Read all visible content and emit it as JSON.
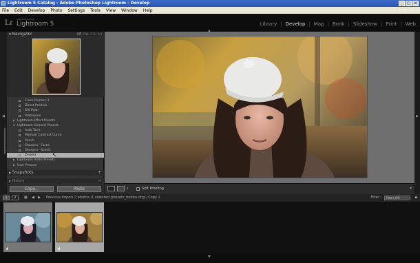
{
  "window": {
    "title": "Lightroom 5 Catalog - Adobe Photoshop Lightroom - Develop",
    "buttons": [
      "_",
      "□",
      "×"
    ]
  },
  "menu": [
    "File",
    "Edit",
    "Develop",
    "Photo",
    "Settings",
    "Tools",
    "View",
    "Window",
    "Help"
  ],
  "brand": {
    "logo": "Lr",
    "small": "Adobe Photoshop",
    "name": "Lightroom 5"
  },
  "modules": [
    "Library",
    "Develop",
    "Map",
    "Book",
    "Slideshow",
    "Print",
    "Web"
  ],
  "active_module": "Develop",
  "navigator": {
    "title": "Navigator",
    "zoom": [
      "FIT",
      "FILL",
      "1:1",
      "1:3"
    ]
  },
  "presets": [
    {
      "label": "Cross Process 3",
      "indent": true
    },
    {
      "label": "Direct Positive",
      "indent": true
    },
    {
      "label": "Old Polar",
      "indent": true
    },
    {
      "label": "Yesteryear",
      "indent": true
    },
    {
      "label": "Lightroom Effect Presets",
      "indent": false,
      "collapsed": true
    },
    {
      "label": "Lightroom General Presets",
      "indent": false,
      "collapsed": false
    },
    {
      "label": "Auto Tone",
      "indent": true
    },
    {
      "label": "Medium Contrast Curve",
      "indent": true
    },
    {
      "label": "Punch",
      "indent": true
    },
    {
      "label": "Sharpen - Faces",
      "indent": true
    },
    {
      "label": "Sharpen - Scenic",
      "indent": true
    },
    {
      "label": "Zeroed",
      "indent": true,
      "selected": true
    },
    {
      "label": "Lightroom Video Presets",
      "indent": false,
      "collapsed": true
    },
    {
      "label": "User Presets",
      "indent": false,
      "collapsed": true
    }
  ],
  "panels": {
    "snapshots": "Snapshots",
    "history": "History"
  },
  "buttons": {
    "copy": "Copy...",
    "paste": "Paste"
  },
  "toolbar": {
    "soft_proofing": "Soft Proofing"
  },
  "filmstrip_bar": {
    "screens": [
      "1",
      "2"
    ],
    "source": "Previous Import",
    "info": "2 photos /1 selected /presets_before.dng / Copy 1",
    "filter_label": "Filter :",
    "filter_value": "Filters Off"
  },
  "colors": {
    "accent": "#3c6ac8",
    "panel": "#353535",
    "background": "#6e6e6e"
  }
}
